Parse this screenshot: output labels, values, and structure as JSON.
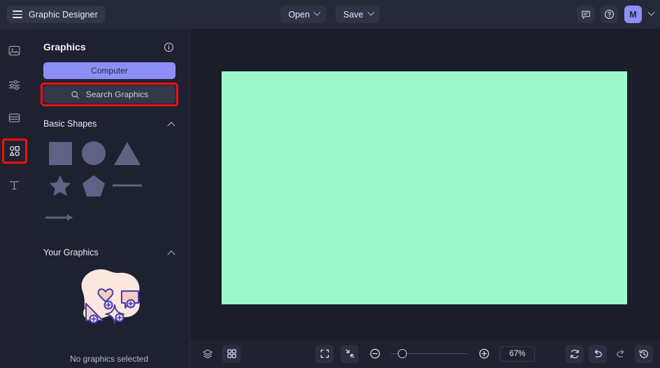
{
  "app": {
    "title": "Graphic Designer",
    "menu_icon": "hamburger-icon"
  },
  "topbar": {
    "open_label": "Open",
    "save_label": "Save",
    "comment_icon": "comment-icon",
    "help_icon": "help-circle-icon",
    "avatar_initial": "M",
    "avatar_color": "#8e8ef7"
  },
  "rail": {
    "items": [
      {
        "name": "image-icon",
        "label": "Image",
        "selected": false
      },
      {
        "name": "adjustments-icon",
        "label": "Adjust",
        "selected": false
      },
      {
        "name": "layout-icon",
        "label": "Layout",
        "selected": false
      },
      {
        "name": "shapes-icon",
        "label": "Graphics",
        "selected": true
      },
      {
        "name": "text-icon",
        "label": "Text",
        "selected": false
      }
    ],
    "highlight_color": "#fb0e0e"
  },
  "panel": {
    "title": "Graphics",
    "info_icon": "info-icon",
    "computer_button": "Computer",
    "search_placeholder": "Search Graphics",
    "search_icon": "search-icon",
    "sections": [
      {
        "title": "Basic Shapes",
        "collapsed": false,
        "shapes": [
          "square",
          "circle",
          "triangle",
          "star",
          "pentagon",
          "line",
          "arrow"
        ]
      },
      {
        "title": "Your Graphics",
        "collapsed": false,
        "empty_text": "No graphics selected"
      }
    ]
  },
  "canvas": {
    "fill_color": "#9df9cd"
  },
  "bottombar": {
    "layers_icon": "layers-icon",
    "grid_icon": "grid-icon",
    "fit_icon": "fit-screen-icon",
    "shrink_icon": "collapse-icon",
    "zoom_out_icon": "zoom-out-icon",
    "zoom_in_icon": "zoom-in-icon",
    "zoom_value": "67%",
    "zoom_slider_percent": 10,
    "reset_icon": "reset-icon",
    "undo_icon": "undo-icon",
    "redo_icon": "redo-icon",
    "history_icon": "history-icon"
  }
}
